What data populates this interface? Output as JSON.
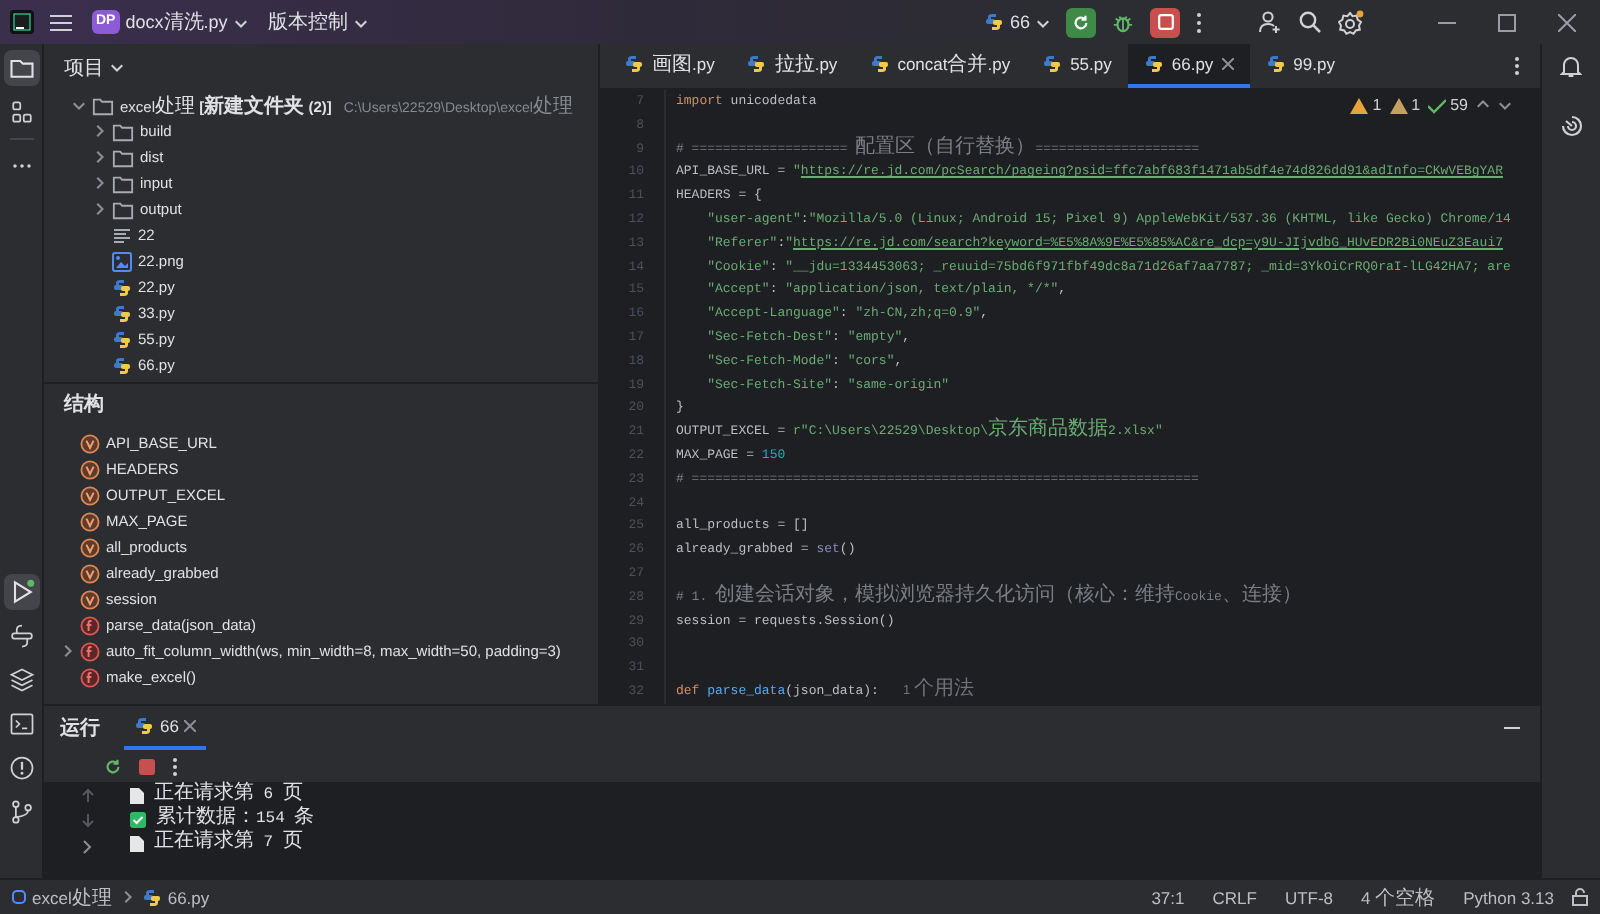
{
  "title_bar": {
    "project_badge": "DP",
    "project_name": "docx清洗.py",
    "vcs": "版本控制",
    "run_config": "66"
  },
  "tool_strip": {
    "top": [
      {
        "kind": "project",
        "selected": true
      },
      {
        "kind": "structure",
        "selected": false
      },
      {
        "kind": "more",
        "selected": false
      }
    ],
    "bottom": [
      {
        "kind": "run",
        "selected": true
      },
      {
        "kind": "python",
        "selected": false
      },
      {
        "kind": "layers",
        "selected": false
      },
      {
        "kind": "terminal",
        "selected": false
      },
      {
        "kind": "problems",
        "selected": false
      },
      {
        "kind": "git",
        "selected": false
      }
    ]
  },
  "project": {
    "title": "项目",
    "root": {
      "name": "excel处理 **[新建文件夹 (2)]**",
      "path": "C:\\Users\\22529\\Desktop\\excel处理",
      "expanded": true,
      "children": [
        {
          "name": "build",
          "kind": "folder",
          "expanded": false
        },
        {
          "name": "dist",
          "kind": "folder",
          "expanded": false
        },
        {
          "name": "input",
          "kind": "folder",
          "expanded": false
        },
        {
          "name": "output",
          "kind": "folder",
          "expanded": false
        },
        {
          "name": "22",
          "kind": "text"
        },
        {
          "name": "22.png",
          "kind": "image"
        },
        {
          "name": "22.py",
          "kind": "python"
        },
        {
          "name": "33.py",
          "kind": "python"
        },
        {
          "name": "55.py",
          "kind": "python"
        },
        {
          "name": "66.py",
          "kind": "python"
        }
      ]
    }
  },
  "structure": {
    "title": "结构",
    "items": [
      {
        "name": "API_BASE_URL",
        "kind": "variable",
        "has_children": false
      },
      {
        "name": "HEADERS",
        "kind": "variable",
        "has_children": false
      },
      {
        "name": "OUTPUT_EXCEL",
        "kind": "variable",
        "has_children": false
      },
      {
        "name": "MAX_PAGE",
        "kind": "variable",
        "has_children": false
      },
      {
        "name": "all_products",
        "kind": "variable",
        "has_children": false
      },
      {
        "name": "already_grabbed",
        "kind": "variable",
        "has_children": false
      },
      {
        "name": "session",
        "kind": "variable",
        "has_children": false
      },
      {
        "name": "parse_data(json_data)",
        "kind": "function",
        "has_children": false
      },
      {
        "name": "auto_fit_column_width(ws, min_width=8, max_width=50, padding=3)",
        "kind": "function",
        "has_children": true
      },
      {
        "name": "make_excel()",
        "kind": "function",
        "has_children": false
      }
    ]
  },
  "editor": {
    "tabs": [
      {
        "label": "画图.py",
        "selected": false
      },
      {
        "label": "拉拉.py",
        "selected": false
      },
      {
        "label": "concat合并.py",
        "selected": false
      },
      {
        "label": "55.py",
        "selected": false
      },
      {
        "label": "66.py",
        "selected": true
      },
      {
        "label": "99.py",
        "selected": false
      }
    ],
    "inspections": {
      "warnings": "1",
      "weak_warnings": "1",
      "passed": "59"
    },
    "lines": [
      {
        "number": "7",
        "segments": [
          {
            "kind": "kw",
            "text": "import"
          },
          {
            "kind": "plain",
            "text": " unicodedata"
          }
        ]
      },
      {
        "number": "8"
      },
      {
        "number": "9",
        "segments": [
          {
            "kind": "comment",
            "text": "# ==================== 配置区（自行替换）====================="
          }
        ]
      },
      {
        "number": "10",
        "segments": [
          {
            "kind": "plain",
            "text": "API_BASE_URL = "
          },
          {
            "kind": "str",
            "text": "\""
          },
          {
            "kind": "link",
            "text": "https://re.jd.com/pcSearch/pageing?psid=ffc7abf683f1471ab5df4e74d826dd91&adInfo=CKwVEBgYAR"
          }
        ]
      },
      {
        "number": "11",
        "segments": [
          {
            "kind": "plain",
            "text": "HEADERS = {"
          }
        ]
      },
      {
        "number": "12",
        "segments": [
          {
            "kind": "str",
            "text": "    \"user-agent\""
          },
          {
            "kind": "plain",
            "text": ":"
          },
          {
            "kind": "str",
            "text": "\"Mozilla/5.0 (Linux; Android 15; Pixel 9) AppleWebKit/537.36 (KHTML, like Gecko) Chrome/14"
          }
        ]
      },
      {
        "number": "13",
        "segments": [
          {
            "kind": "str",
            "text": "    \"Referer\""
          },
          {
            "kind": "plain",
            "text": ":"
          },
          {
            "kind": "str",
            "text": "\""
          },
          {
            "kind": "link",
            "text": "https://re.jd.com/search?keyword=%E5%8A%9E%E5%85%AC&re_dcp=y9U-JIjvdbG_HUvEDR2Bi0NEuZ3Eaui7"
          }
        ]
      },
      {
        "number": "14",
        "segments": [
          {
            "kind": "str",
            "text": "    \"Cookie\""
          },
          {
            "kind": "plain",
            "text": ": "
          },
          {
            "kind": "str",
            "text": "\"__jdu=1334453063; _reuuid=75bd6f971fbf49dc8a71d26af7aa7787; _mid=3YkOiCrRQ0raI-lLG42HA7; are"
          }
        ]
      },
      {
        "number": "15",
        "segments": [
          {
            "kind": "str",
            "text": "    \"Accept\""
          },
          {
            "kind": "plain",
            "text": ": "
          },
          {
            "kind": "str",
            "text": "\"application/json, text/plain, */*\""
          },
          {
            "kind": "plain",
            "text": ","
          }
        ]
      },
      {
        "number": "16",
        "segments": [
          {
            "kind": "str",
            "text": "    \"Accept-Language\""
          },
          {
            "kind": "plain",
            "text": ": "
          },
          {
            "kind": "str",
            "text": "\"zh-CN,zh;q=0.9\""
          },
          {
            "kind": "plain",
            "text": ","
          }
        ]
      },
      {
        "number": "17",
        "segments": [
          {
            "kind": "str",
            "text": "    \"Sec-Fetch-Dest\""
          },
          {
            "kind": "plain",
            "text": ": "
          },
          {
            "kind": "str",
            "text": "\"empty\""
          },
          {
            "kind": "plain",
            "text": ","
          }
        ]
      },
      {
        "number": "18",
        "segments": [
          {
            "kind": "str",
            "text": "    \"Sec-Fetch-Mode\""
          },
          {
            "kind": "plain",
            "text": ": "
          },
          {
            "kind": "str",
            "text": "\"cors\""
          },
          {
            "kind": "plain",
            "text": ","
          }
        ]
      },
      {
        "number": "19",
        "segments": [
          {
            "kind": "str",
            "text": "    \"Sec-Fetch-Site\""
          },
          {
            "kind": "plain",
            "text": ": "
          },
          {
            "kind": "str",
            "text": "\"same-origin\""
          }
        ]
      },
      {
        "number": "20",
        "segments": [
          {
            "kind": "plain",
            "text": "}"
          }
        ]
      },
      {
        "number": "21",
        "segments": [
          {
            "kind": "plain",
            "text": "OUTPUT_EXCEL = "
          },
          {
            "kind": "str",
            "text": "r\"C:\\Users\\22529\\Desktop\\京东商品数据2.xlsx\""
          }
        ]
      },
      {
        "number": "22",
        "segments": [
          {
            "kind": "plain",
            "text": "MAX_PAGE = "
          },
          {
            "kind": "num",
            "text": "150"
          }
        ]
      },
      {
        "number": "23",
        "segments": [
          {
            "kind": "comment",
            "text": "# ================================================================="
          }
        ]
      },
      {
        "number": "24"
      },
      {
        "number": "25",
        "segments": [
          {
            "kind": "plain",
            "text": "all_products = []"
          }
        ]
      },
      {
        "number": "26",
        "segments": [
          {
            "kind": "plain",
            "text": "already_grabbed = "
          },
          {
            "kind": "builtin",
            "text": "set"
          },
          {
            "kind": "plain",
            "text": "()"
          }
        ]
      },
      {
        "number": "27"
      },
      {
        "number": "28",
        "segments": [
          {
            "kind": "comment",
            "text": "# 1. 创建会话对象，模拟浏览器持久化访问（核心：维持Cookie、连接）"
          }
        ]
      },
      {
        "number": "29",
        "segments": [
          {
            "kind": "plain",
            "text": "session = requests.Session()"
          }
        ]
      },
      {
        "number": "30"
      },
      {
        "number": "31"
      },
      {
        "number": "32",
        "segments": [
          {
            "kind": "kw",
            "text": "def"
          },
          {
            "kind": "fn",
            "text": " parse_data"
          },
          {
            "kind": "plain",
            "text": "(json_data):"
          }
        ],
        "hint": "1 个用法"
      }
    ]
  },
  "run_panel": {
    "title": "运行",
    "tabs": [
      {
        "label": "66",
        "selected": true
      }
    ],
    "output": [
      {
        "kind": "info",
        "text": "正在请求第 6 页"
      },
      {
        "kind": "success",
        "text": "累计数据：154 条"
      },
      {
        "kind": "info",
        "text": "正在请求第 7 页"
      }
    ]
  },
  "status_bar": {
    "breadcrumbs": [
      {
        "kind": "module",
        "label": "excel处理"
      },
      {
        "kind": "python",
        "label": "66.py"
      }
    ],
    "items": [
      "37:1",
      "CRLF",
      "UTF-8",
      "4 个空格",
      "Python 3.13"
    ]
  }
}
